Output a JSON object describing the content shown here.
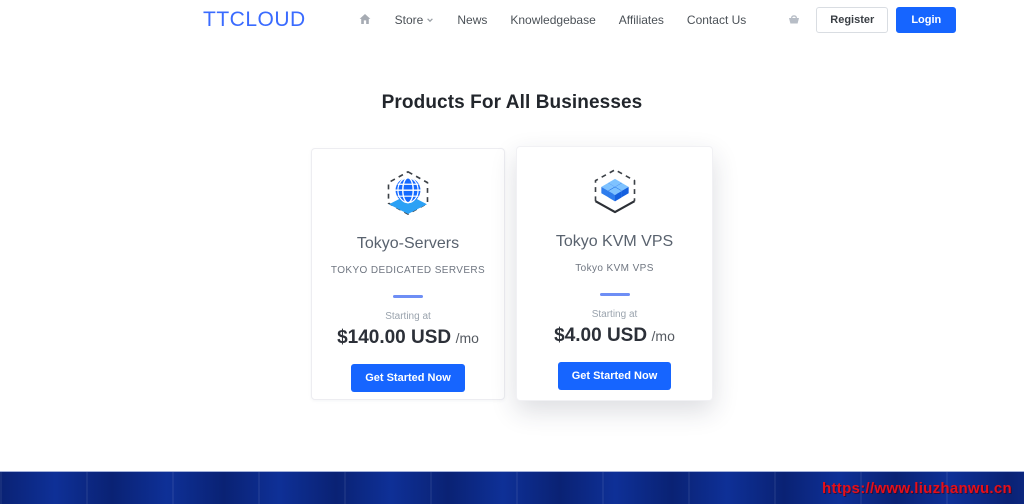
{
  "header": {
    "brand": "TTCLOUD",
    "nav": [
      {
        "label": "Store",
        "has_caret": true
      },
      {
        "label": "News"
      },
      {
        "label": "Knowledgebase"
      },
      {
        "label": "Affiliates"
      },
      {
        "label": "Contact Us"
      }
    ],
    "icons": {
      "home": "home-icon",
      "cart": "cart-icon",
      "caret": "chevron-down-icon"
    },
    "register_label": "Register",
    "login_label": "Login"
  },
  "main": {
    "title": "Products For All Businesses",
    "products": [
      {
        "name": "Tokyo-Servers",
        "tagline": "TOKYO DEDICATED SERVERS",
        "starting_label": "Starting at",
        "price": "$140.00 USD",
        "period": "/mo",
        "cta_label": "Get Started Now",
        "icon": "globe-hexagon-icon"
      },
      {
        "name": "Tokyo KVM VPS",
        "tagline": "Tokyo KVM VPS",
        "starting_label": "Starting at",
        "price": "$4.00 USD",
        "period": "/mo",
        "cta_label": "Get Started Now",
        "icon": "kvm-cubes-icon"
      }
    ]
  },
  "footer": {
    "watermark": "https://www.liuzhanwu.cn"
  },
  "colors": {
    "accent": "#1665ff",
    "logo_blue": "#3a6bff",
    "divider_blue": "#6e8ef5",
    "footer_navy": "#0b2a85",
    "watermark_red": "#e50f1a"
  }
}
